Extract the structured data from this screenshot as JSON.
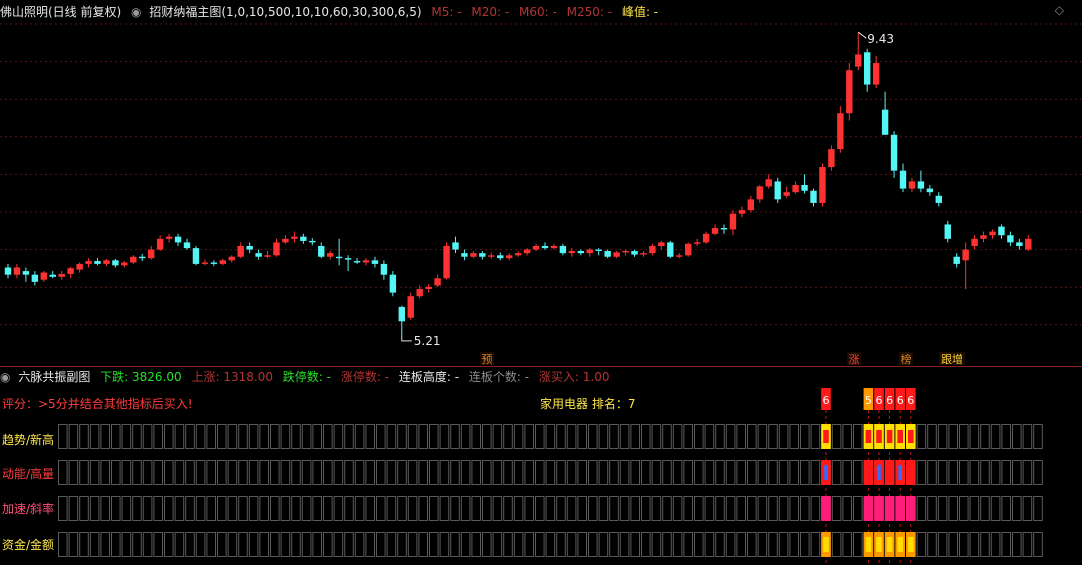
{
  "main": {
    "title": "佛山照明(日线 前复权)",
    "indicator": "招财纳福主图(1,0,10,500,10,10,60,30,300,6,5)",
    "ma5": "M5: -",
    "ma20": "M20: -",
    "ma60": "M60: -",
    "ma250": "M250: -",
    "peak": "峰值: -",
    "high_label": "9.43",
    "low_label": "5.21",
    "signals": [
      {
        "text": "预",
        "color": "#d9822b"
      },
      {
        "text": "涨",
        "color": "#ff3b3b"
      },
      {
        "text": "榜",
        "color": "#d9822b"
      },
      {
        "text": "跟增",
        "color": "#ffd23a"
      }
    ]
  },
  "sub": {
    "title": "六脉共振副图",
    "down": "下跌: 3826.00",
    "up": "上涨: 1318.00",
    "limitdown": "跌停数: -",
    "limitup": "涨停数: -",
    "board_height": "连板高度: -",
    "board_count": "连板个数: -",
    "buy": "涨买入: 1.00",
    "score": "评分：>5分并结合其他指标后买入!",
    "sector": "家用电器 排名：7",
    "rank_numbers": [
      "6",
      "5",
      "6",
      "6",
      "6",
      "6"
    ],
    "rows": [
      "趋势/新高",
      "动能/高量",
      "加速/斜率",
      "资金/金额"
    ]
  },
  "chart_data": {
    "type": "candlestick",
    "ylim": [
      5.0,
      9.6
    ],
    "annotations": {
      "max": 9.43,
      "min": 5.21
    },
    "candles": [
      [
        6.15,
        6.05,
        6.2,
        6.0
      ],
      [
        6.05,
        6.15,
        6.2,
        6.0
      ],
      [
        6.1,
        6.05,
        6.15,
        5.95
      ],
      [
        6.05,
        5.95,
        6.1,
        5.9
      ],
      [
        5.98,
        6.08,
        6.1,
        5.95
      ],
      [
        6.05,
        6.02,
        6.1,
        6.0
      ],
      [
        6.02,
        6.06,
        6.1,
        5.98
      ],
      [
        6.06,
        6.14,
        6.16,
        6.0
      ],
      [
        6.12,
        6.2,
        6.22,
        6.08
      ],
      [
        6.2,
        6.24,
        6.28,
        6.15
      ],
      [
        6.24,
        6.2,
        6.28,
        6.18
      ],
      [
        6.2,
        6.25,
        6.27,
        6.17
      ],
      [
        6.25,
        6.18,
        6.27,
        6.15
      ],
      [
        6.18,
        6.22,
        6.24,
        6.15
      ],
      [
        6.22,
        6.3,
        6.32,
        6.2
      ],
      [
        6.3,
        6.28,
        6.34,
        6.24
      ],
      [
        6.28,
        6.4,
        6.45,
        6.26
      ],
      [
        6.4,
        6.55,
        6.6,
        6.38
      ],
      [
        6.55,
        6.58,
        6.62,
        6.5
      ],
      [
        6.58,
        6.5,
        6.62,
        6.45
      ],
      [
        6.5,
        6.42,
        6.55,
        6.4
      ],
      [
        6.42,
        6.2,
        6.45,
        6.18
      ],
      [
        6.2,
        6.22,
        6.26,
        6.18
      ],
      [
        6.22,
        6.2,
        6.25,
        6.17
      ],
      [
        6.2,
        6.25,
        6.27,
        6.18
      ],
      [
        6.25,
        6.3,
        6.32,
        6.22
      ],
      [
        6.3,
        6.45,
        6.5,
        6.28
      ],
      [
        6.45,
        6.4,
        6.5,
        6.35
      ],
      [
        6.35,
        6.3,
        6.4,
        6.26
      ],
      [
        6.3,
        6.32,
        6.38,
        6.28
      ],
      [
        6.32,
        6.5,
        6.55,
        6.3
      ],
      [
        6.5,
        6.55,
        6.6,
        6.48
      ],
      [
        6.55,
        6.58,
        6.65,
        6.5
      ],
      [
        6.58,
        6.52,
        6.62,
        6.48
      ],
      [
        6.52,
        6.5,
        6.56,
        6.46
      ],
      [
        6.45,
        6.3,
        6.5,
        6.28
      ],
      [
        6.3,
        6.35,
        6.38,
        6.26
      ],
      [
        6.3,
        6.28,
        6.55,
        6.18
      ],
      [
        6.28,
        6.26,
        6.32,
        6.1
      ],
      [
        6.24,
        6.22,
        6.28,
        6.2
      ],
      [
        6.22,
        6.25,
        6.28,
        6.18
      ],
      [
        6.25,
        6.2,
        6.3,
        6.15
      ],
      [
        6.2,
        6.05,
        6.25,
        5.98
      ],
      [
        6.05,
        5.8,
        6.1,
        5.75
      ],
      [
        5.6,
        5.4,
        5.62,
        5.21
      ],
      [
        5.45,
        5.75,
        5.8,
        5.42
      ],
      [
        5.75,
        5.85,
        5.9,
        5.72
      ],
      [
        5.85,
        5.88,
        5.92,
        5.8
      ],
      [
        5.9,
        6.0,
        6.05,
        5.88
      ],
      [
        6.0,
        6.45,
        6.5,
        5.98
      ],
      [
        6.5,
        6.4,
        6.58,
        6.35
      ],
      [
        6.35,
        6.3,
        6.4,
        6.25
      ],
      [
        6.3,
        6.35,
        6.38,
        6.28
      ],
      [
        6.35,
        6.3,
        6.38,
        6.26
      ],
      [
        6.3,
        6.32,
        6.36,
        6.27
      ],
      [
        6.32,
        6.28,
        6.36,
        6.25
      ],
      [
        6.28,
        6.32,
        6.35,
        6.25
      ],
      [
        6.32,
        6.35,
        6.38,
        6.3
      ],
      [
        6.35,
        6.4,
        6.42,
        6.32
      ],
      [
        6.4,
        6.45,
        6.48,
        6.38
      ],
      [
        6.45,
        6.42,
        6.5,
        6.4
      ],
      [
        6.42,
        6.45,
        6.48,
        6.4
      ],
      [
        6.45,
        6.35,
        6.48,
        6.32
      ],
      [
        6.35,
        6.38,
        6.42,
        6.3
      ],
      [
        6.38,
        6.35,
        6.4,
        6.32
      ],
      [
        6.35,
        6.4,
        6.42,
        6.3
      ],
      [
        6.4,
        6.38,
        6.42,
        6.32
      ],
      [
        6.38,
        6.3,
        6.4,
        6.28
      ],
      [
        6.3,
        6.36,
        6.38,
        6.28
      ],
      [
        6.36,
        6.38,
        6.4,
        6.32
      ],
      [
        6.38,
        6.33,
        6.4,
        6.3
      ],
      [
        6.33,
        6.35,
        6.38,
        6.3
      ],
      [
        6.35,
        6.45,
        6.48,
        6.32
      ],
      [
        6.45,
        6.5,
        6.52,
        6.4
      ],
      [
        6.5,
        6.3,
        6.52,
        6.28
      ],
      [
        6.3,
        6.32,
        6.35,
        6.28
      ],
      [
        6.32,
        6.48,
        6.5,
        6.3
      ],
      [
        6.48,
        6.5,
        6.55,
        6.45
      ],
      [
        6.5,
        6.62,
        6.65,
        6.48
      ],
      [
        6.62,
        6.7,
        6.75,
        6.6
      ],
      [
        6.7,
        6.68,
        6.75,
        6.62
      ],
      [
        6.68,
        6.9,
        6.95,
        6.6
      ],
      [
        6.9,
        6.95,
        7.0,
        6.85
      ],
      [
        6.95,
        7.1,
        7.15,
        6.92
      ],
      [
        7.1,
        7.28,
        7.3,
        7.05
      ],
      [
        7.28,
        7.38,
        7.45,
        7.25
      ],
      [
        7.35,
        7.1,
        7.4,
        7.05
      ],
      [
        7.15,
        7.2,
        7.28,
        7.12
      ],
      [
        7.2,
        7.3,
        7.35,
        7.18
      ],
      [
        7.3,
        7.22,
        7.45,
        7.18
      ],
      [
        7.22,
        7.05,
        7.25,
        7.0
      ],
      [
        7.05,
        7.55,
        7.6,
        7.0
      ],
      [
        7.55,
        7.8,
        7.85,
        7.5
      ],
      [
        7.8,
        8.3,
        8.4,
        7.75
      ],
      [
        8.3,
        8.9,
        9.0,
        8.2
      ],
      [
        8.95,
        9.12,
        9.43,
        8.9
      ],
      [
        9.15,
        8.7,
        9.2,
        8.6
      ],
      [
        8.7,
        9.0,
        9.1,
        8.65
      ],
      [
        8.35,
        8.0,
        8.6,
        8.0
      ],
      [
        8.0,
        7.5,
        8.05,
        7.4
      ],
      [
        7.5,
        7.25,
        7.6,
        7.2
      ],
      [
        7.25,
        7.35,
        7.4,
        7.2
      ],
      [
        7.35,
        7.25,
        7.5,
        7.2
      ],
      [
        7.25,
        7.2,
        7.3,
        7.15
      ],
      [
        7.15,
        7.05,
        7.2,
        7.0
      ],
      [
        6.75,
        6.55,
        6.8,
        6.5
      ],
      [
        6.3,
        6.2,
        6.35,
        6.15
      ],
      [
        6.25,
        6.4,
        6.5,
        5.85
      ],
      [
        6.45,
        6.55,
        6.6,
        6.4
      ],
      [
        6.55,
        6.6,
        6.65,
        6.5
      ],
      [
        6.6,
        6.65,
        6.68,
        6.55
      ],
      [
        6.72,
        6.6,
        6.75,
        6.55
      ],
      [
        6.6,
        6.5,
        6.65,
        6.45
      ],
      [
        6.5,
        6.45,
        6.55,
        6.4
      ],
      [
        6.4,
        6.55,
        6.6,
        6.38
      ]
    ]
  },
  "colors": {
    "up": "#ff3232",
    "down": "#54f5f5",
    "cell_border": "#5a5a5a",
    "signal_red": "#ff1a1a",
    "signal_yellow": "#ffde00",
    "signal_pink": "#ff1d7a",
    "signal_orange": "#ff9900",
    "signal_blue": "#2f6cff"
  }
}
